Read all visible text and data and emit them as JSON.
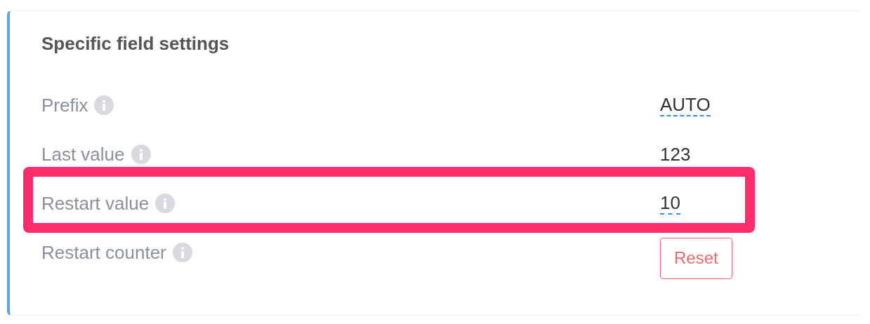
{
  "panel": {
    "title": "Specific field settings",
    "rows": [
      {
        "label": "Prefix",
        "kind": "editable",
        "value": "AUTO",
        "highlighted": false
      },
      {
        "label": "Last value",
        "kind": "text",
        "value": "123",
        "highlighted": false
      },
      {
        "label": "Restart value",
        "kind": "editable",
        "value": "10",
        "highlighted": true
      },
      {
        "label": "Restart counter",
        "kind": "button",
        "value": "Reset",
        "highlighted": false
      }
    ]
  }
}
